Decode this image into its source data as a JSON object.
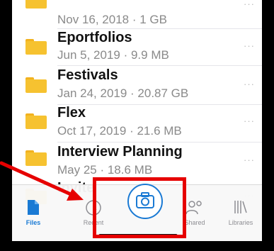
{
  "files": [
    {
      "name": "",
      "meta": "Nov 16, 2018 · 1 GB",
      "more": "···"
    },
    {
      "name": "Eportfolios",
      "meta": "Jun 5, 2019 · 9.9 MB",
      "more": "···"
    },
    {
      "name": "Festivals",
      "meta": "Jan 24, 2019 · 20.87 GB",
      "more": "···"
    },
    {
      "name": "Flex",
      "meta": "Oct 17, 2019 · 21.6 MB",
      "more": "···"
    },
    {
      "name": "Interview Planning",
      "meta": "May 25 · 18.6 MB",
      "more": "···"
    },
    {
      "name": "Invite",
      "meta": "",
      "more": "···"
    }
  ],
  "tabbar": {
    "files": "Files",
    "recent": "Recent",
    "shared": "Shared",
    "libraries": "Libraries"
  },
  "colors": {
    "accent": "#1a7ad4",
    "annotation": "#e60000",
    "folder": "#f6c230"
  },
  "icons": [
    "file-icon",
    "clock-icon",
    "camera-icon",
    "people-icon",
    "library-icon"
  ]
}
